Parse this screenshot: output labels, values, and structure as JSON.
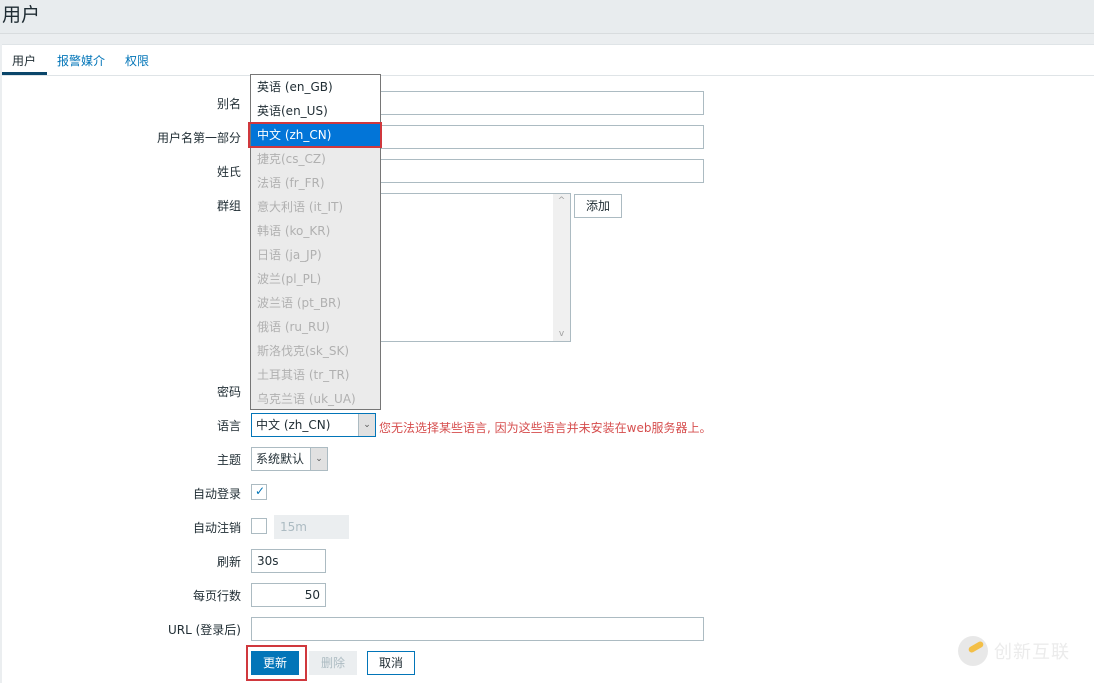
{
  "page": {
    "title": "用户"
  },
  "tabs": [
    {
      "label": "用户",
      "active": true
    },
    {
      "label": "报警媒介",
      "active": false
    },
    {
      "label": "权限",
      "active": false
    }
  ],
  "form": {
    "alias": {
      "label": "别名",
      "value": ""
    },
    "name": {
      "label": "用户名第一部分",
      "value": ""
    },
    "surname": {
      "label": "姓氏",
      "value": ""
    },
    "groups": {
      "label": "群组",
      "add_button": "添加"
    },
    "password": {
      "label": "密码"
    },
    "language": {
      "label": "语言",
      "selected": "中文 (zh_CN)",
      "warning": "您无法选择某些语言, 因为这些语言并未安装在web服务器上。",
      "options": [
        {
          "label": "英语 (en_GB)",
          "enabled": true,
          "selected": false
        },
        {
          "label": "英语(en_US)",
          "enabled": true,
          "selected": false
        },
        {
          "label": "中文 (zh_CN)",
          "enabled": true,
          "selected": true
        },
        {
          "label": "捷克(cs_CZ)",
          "enabled": false,
          "selected": false
        },
        {
          "label": "法语 (fr_FR)",
          "enabled": false,
          "selected": false
        },
        {
          "label": "意大利语 (it_IT)",
          "enabled": false,
          "selected": false
        },
        {
          "label": "韩语 (ko_KR)",
          "enabled": false,
          "selected": false
        },
        {
          "label": "日语 (ja_JP)",
          "enabled": false,
          "selected": false
        },
        {
          "label": "波兰(pl_PL)",
          "enabled": false,
          "selected": false
        },
        {
          "label": "波兰语 (pt_BR)",
          "enabled": false,
          "selected": false
        },
        {
          "label": "俄语 (ru_RU)",
          "enabled": false,
          "selected": false
        },
        {
          "label": "斯洛伐克(sk_SK)",
          "enabled": false,
          "selected": false
        },
        {
          "label": "土耳其语 (tr_TR)",
          "enabled": false,
          "selected": false
        },
        {
          "label": "乌克兰语 (uk_UA)",
          "enabled": false,
          "selected": false
        }
      ]
    },
    "theme": {
      "label": "主题",
      "selected": "系统默认"
    },
    "autologin": {
      "label": "自动登录",
      "checked": true
    },
    "autologout": {
      "label": "自动注销",
      "checked": false,
      "value": "15m"
    },
    "refresh": {
      "label": "刷新",
      "value": "30s"
    },
    "rows_per_page": {
      "label": "每页行数",
      "value": "50"
    },
    "url": {
      "label": "URL (登录后)",
      "value": ""
    }
  },
  "buttons": {
    "update": "更新",
    "delete": "删除",
    "cancel": "取消"
  },
  "watermark": {
    "text": "创新互联"
  },
  "icons": {
    "chevron_down": "⌄",
    "scroll_up": "^",
    "scroll_down": "v",
    "check": "✓"
  },
  "colors": {
    "accent": "#0275b8",
    "warning": "#d64e4e",
    "highlight": "#d0383d"
  }
}
